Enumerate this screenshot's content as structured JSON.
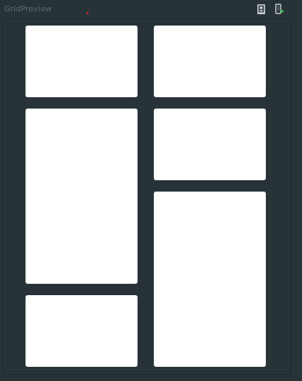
{
  "window": {
    "title": "GridPreview"
  },
  "toolbar": {
    "icons": [
      "portrait-orientation-icon",
      "run-device-icon"
    ]
  },
  "grid": {
    "card_color": "#ffffff",
    "background_color": "#283338"
  }
}
